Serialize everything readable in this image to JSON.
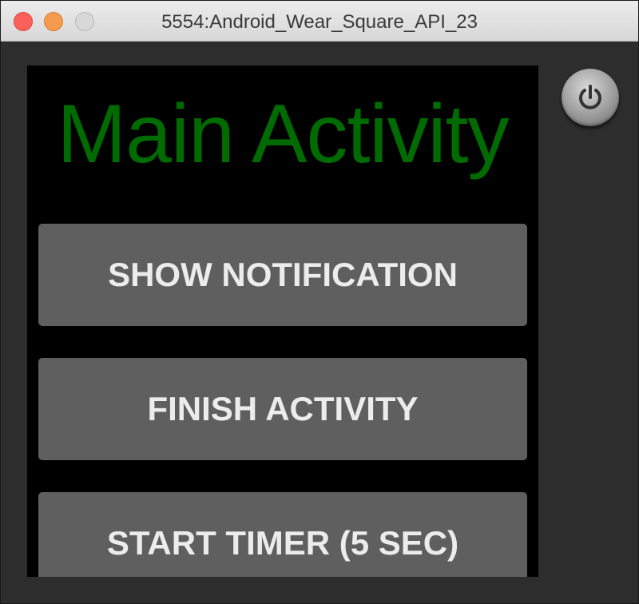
{
  "window": {
    "title": "5554:Android_Wear_Square_API_23"
  },
  "app": {
    "title": "Main Activity",
    "title_color": "#006b00",
    "buttons": [
      {
        "label": "SHOW NOTIFICATION"
      },
      {
        "label": "FINISH ACTIVITY"
      },
      {
        "label": "START TIMER (5 SEC)"
      }
    ]
  },
  "controls": {
    "power_icon": "power-icon"
  }
}
